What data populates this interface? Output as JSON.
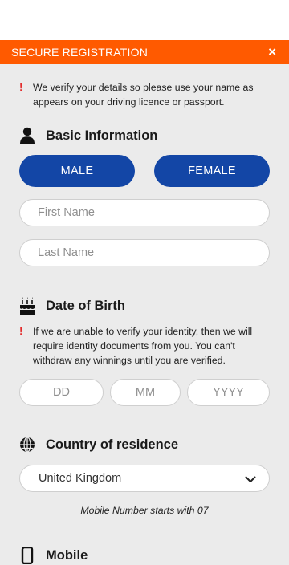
{
  "header": {
    "title": "SECURE REGISTRATION",
    "close_symbol": "×"
  },
  "notices": {
    "name_notice": "We verify your details so please use your name as appears on your driving licence or passport.",
    "dob_notice": "If we are unable to verify your identity, then we will require identity documents from you. You can't withdraw any winnings until you are verified.",
    "bang": "!"
  },
  "basic_info": {
    "title": "Basic Information",
    "icon": "person-icon",
    "male_label": "MALE",
    "female_label": "FEMALE",
    "first_name_placeholder": "First Name",
    "last_name_placeholder": "Last Name"
  },
  "dob": {
    "title": "Date of Birth",
    "icon": "birthday-cake-icon",
    "day_placeholder": "DD",
    "month_placeholder": "MM",
    "year_placeholder": "YYYY"
  },
  "country": {
    "title": "Country of residence",
    "icon": "globe-icon",
    "selected": "United Kingdom",
    "hint": "Mobile Number starts with 07"
  },
  "mobile": {
    "title_partial": "Mobile",
    "icon": "mobile-phone-icon"
  },
  "colors": {
    "accent": "#ff5a00",
    "button": "#1346a6",
    "warning": "#e32b2b",
    "background": "#ebebeb"
  }
}
